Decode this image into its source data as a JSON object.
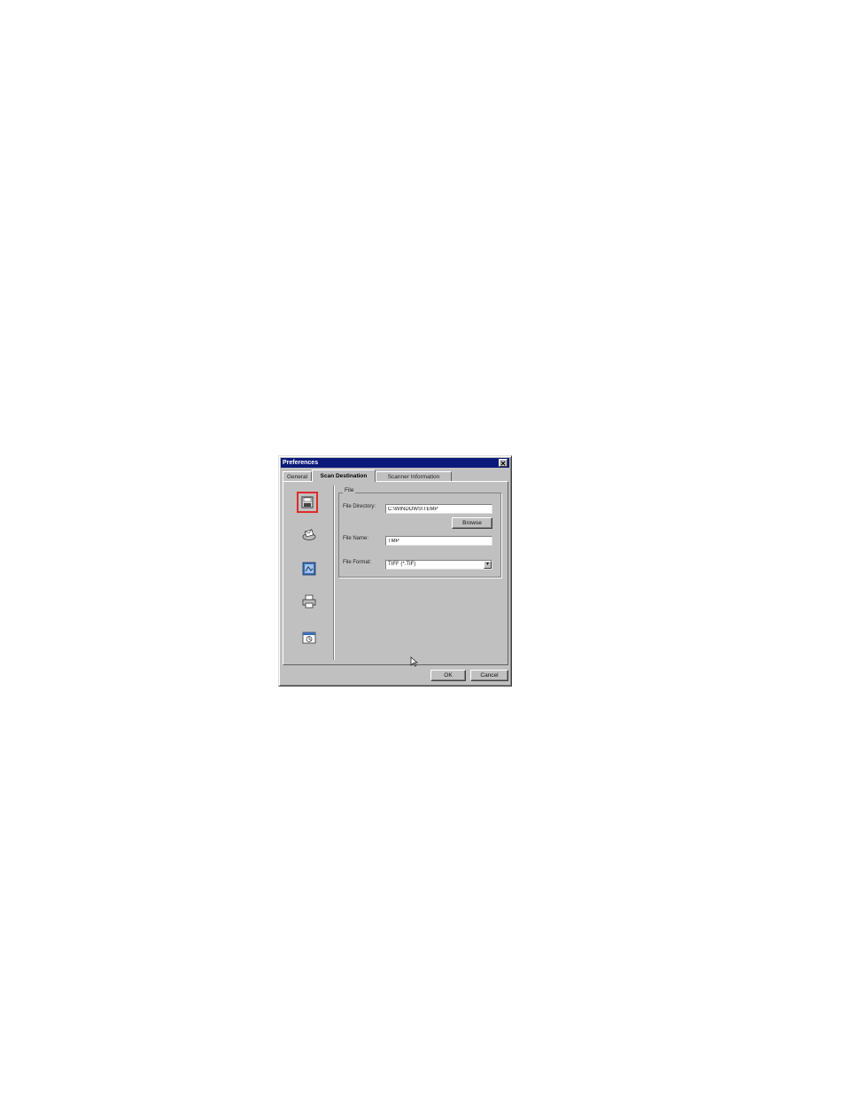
{
  "window": {
    "title": "Preferences",
    "close_glyph": "✕"
  },
  "tabs": [
    {
      "label": "General",
      "active": false
    },
    {
      "label": "Scan Destination",
      "active": true
    },
    {
      "label": "Scanner Information",
      "active": false
    }
  ],
  "destinations": [
    {
      "icon": "floppy-disk-icon",
      "selected": true
    },
    {
      "icon": "email-icon",
      "selected": false
    },
    {
      "icon": "image-editor-icon",
      "selected": false
    },
    {
      "icon": "printer-icon",
      "selected": false
    },
    {
      "icon": "application-icon",
      "selected": false
    }
  ],
  "file_group": {
    "title": "File",
    "directory_label": "File Directory:",
    "directory_value": "C:\\WINDOWS\\TEMP",
    "browse_label": "Browse",
    "name_label": "File Name:",
    "name_value": "TMP",
    "format_label": "File Format:",
    "format_value": "TIFF (*.TIF)"
  },
  "footer": {
    "ok_label": "OK",
    "cancel_label": "Cancel"
  },
  "colors": {
    "titlebar": "#0a1a7a",
    "face": "#c0c0c0",
    "selection_border": "#e02a2a"
  }
}
